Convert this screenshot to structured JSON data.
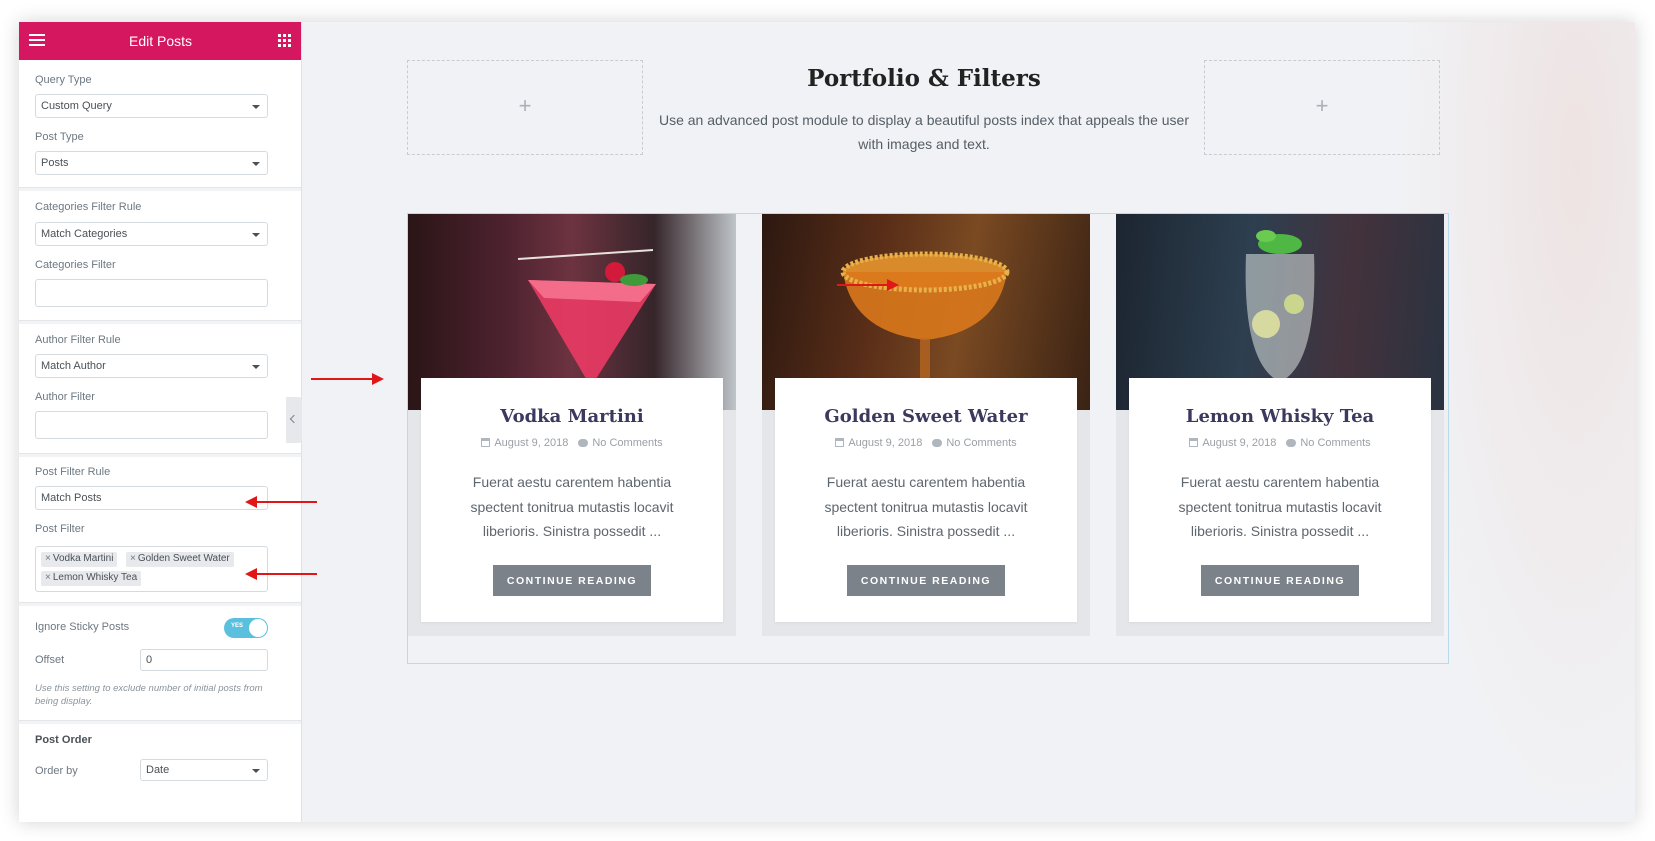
{
  "header": {
    "title": "Edit Posts",
    "accent_color": "#d5175f",
    "menu_icon": "hamburger-icon",
    "apps_icon": "grid-icon"
  },
  "sidebar": {
    "query_type": {
      "label": "Query Type",
      "value": "Custom Query"
    },
    "post_type": {
      "label": "Post Type",
      "value": "Posts"
    },
    "categories_filter_rule": {
      "label": "Categories Filter Rule",
      "value": "Match Categories"
    },
    "categories_filter": {
      "label": "Categories Filter",
      "value": ""
    },
    "author_filter_rule": {
      "label": "Author Filter Rule",
      "value": "Match Author"
    },
    "author_filter": {
      "label": "Author Filter",
      "value": ""
    },
    "post_filter_rule": {
      "label": "Post Filter Rule",
      "value": "Match Posts"
    },
    "post_filter": {
      "label": "Post Filter",
      "tags": [
        "Vodka Martini",
        "Golden Sweet Water",
        "Lemon Whisky Tea"
      ],
      "remove_glyph": "×"
    },
    "ignore_sticky": {
      "label": "Ignore Sticky Posts",
      "toggle_text": "YES",
      "on": true
    },
    "offset": {
      "label": "Offset",
      "value": "0",
      "note": "Use this setting to exclude number of initial posts from being display."
    },
    "post_order": {
      "heading": "Post Order",
      "order_by_label": "Order by",
      "order_by_value": "Date"
    }
  },
  "section": {
    "title": "Portfolio & Filters",
    "description": "Use an advanced post module to display a beautiful posts index that appeals the user with images and text.",
    "add_glyph": "+"
  },
  "posts": [
    {
      "title": "Vodka Martini",
      "date": "August 9, 2018",
      "comments": "No Comments",
      "excerpt": "Fuerat aestu carentem habentia spectent tonitrua mutastis locavit liberioris. Sinistra possedit ...",
      "button": "CONTINUE READING"
    },
    {
      "title": "Golden Sweet Water",
      "date": "August 9, 2018",
      "comments": "No Comments",
      "excerpt": "Fuerat aestu carentem habentia spectent tonitrua mutastis locavit liberioris. Sinistra possedit ...",
      "button": "CONTINUE READING"
    },
    {
      "title": "Lemon Whisky Tea",
      "date": "August 9, 2018",
      "comments": "No Comments",
      "excerpt": "Fuerat aestu carentem habentia spectent tonitrua mutastis locavit liberioris. Sinistra possedit ...",
      "button": "CONTINUE READING"
    }
  ],
  "annotation_color": "#e11616"
}
